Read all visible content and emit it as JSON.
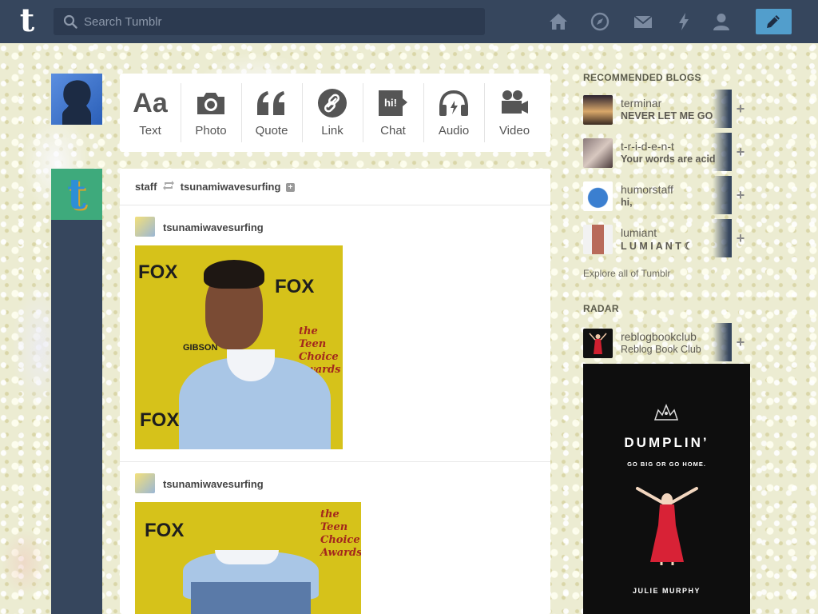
{
  "header": {
    "logo": "t",
    "search_placeholder": "Search Tumblr",
    "nav_icons": [
      "home-icon",
      "explore-icon",
      "inbox-icon",
      "activity-icon",
      "account-icon"
    ],
    "compose_icon": "pencil-icon",
    "colors": {
      "bar": "#36465d",
      "compose": "#529ecc"
    }
  },
  "post_types": [
    {
      "glyph": "Aa",
      "label": "Text",
      "icon": "text-icon"
    },
    {
      "glyph": "",
      "label": "Photo",
      "icon": "camera-icon"
    },
    {
      "glyph": "❝",
      "label": "Quote",
      "icon": "quote-icon"
    },
    {
      "glyph": "",
      "label": "Link",
      "icon": "link-icon"
    },
    {
      "glyph": "hi!",
      "label": "Chat",
      "icon": "chat-icon"
    },
    {
      "glyph": "",
      "label": "Audio",
      "icon": "headphones-icon"
    },
    {
      "glyph": "",
      "label": "Video",
      "icon": "video-camera-icon"
    }
  ],
  "post": {
    "reblogger": "staff",
    "source": "tsunamiwavesurfing",
    "entries": [
      {
        "username": "tsunamiwavesurfing"
      },
      {
        "username": "tsunamiwavesurfing"
      }
    ],
    "photo_text": {
      "fox": "FOX",
      "teen": "the Teen Choice Awards",
      "gibson": "GIBSON"
    }
  },
  "sidebar": {
    "recommended_title": "RECOMMENDED BLOGS",
    "recommended": [
      {
        "name": "terminar",
        "desc": "NEVER LET ME GO"
      },
      {
        "name": "t-r-i-d-e-n-t",
        "desc": "Your words are acid"
      },
      {
        "name": "humorstaff",
        "desc": "hi,"
      },
      {
        "name": "lumiant",
        "desc": "L U M I A N T ☾"
      }
    ],
    "explore_label": "Explore all of Tumblr",
    "radar_title": "RADAR",
    "radar": {
      "name": "reblogbookclub",
      "desc": "Reblog Book Club"
    },
    "ad": {
      "title": "DUMPLIN’",
      "subtitle": "GO BIG OR GO HOME.",
      "author": "JULIE MURPHY"
    }
  }
}
